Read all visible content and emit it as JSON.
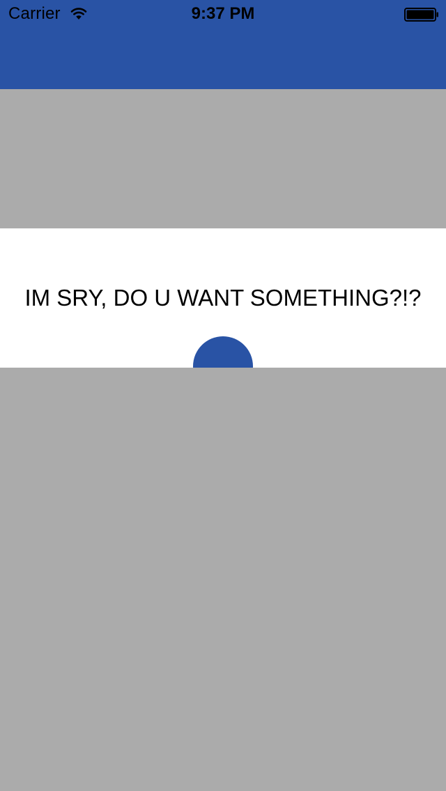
{
  "status_bar": {
    "carrier": "Carrier",
    "time": "9:37 PM",
    "wifi_icon": "wifi-icon",
    "battery_icon": "battery-icon"
  },
  "message": {
    "text": "IM SRY, DO U WANT SOMETHING?!?"
  },
  "colors": {
    "header": "#2953a5",
    "background": "#ababab",
    "panel": "#ffffff",
    "accent": "#2953a5"
  }
}
